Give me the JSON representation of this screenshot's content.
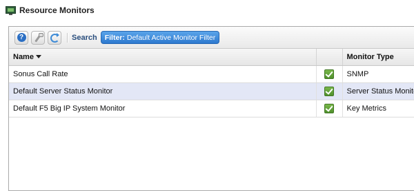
{
  "page": {
    "title": "Resource Monitors"
  },
  "toolbar": {
    "search_label": "Search",
    "filter_key": "Filter:",
    "filter_value": "Default Active Monitor Filter"
  },
  "table": {
    "columns": [
      {
        "label": "Name",
        "sorted": "descending"
      },
      {
        "label": ""
      },
      {
        "label": "Monitor Type"
      }
    ],
    "rows": [
      {
        "name": "Sonus Call Rate",
        "enabled": true,
        "type": "SNMP",
        "selected": false
      },
      {
        "name": "Default Server Status Monitor",
        "enabled": true,
        "type": "Server Status Monitor",
        "selected": true
      },
      {
        "name": "Default F5 Big IP System Monitor",
        "enabled": true,
        "type": "Key Metrics",
        "selected": false
      }
    ]
  },
  "icons": {
    "title": "monitor-icon",
    "help": "help-icon",
    "settings": "wrench-icon",
    "refresh": "refresh-icon",
    "enabled": "checkmark-icon"
  },
  "colors": {
    "accent": "#2d79cf",
    "selected_row": "#e3e7f6",
    "check_green": "#5a9a35",
    "search_text": "#2b4f7e"
  }
}
